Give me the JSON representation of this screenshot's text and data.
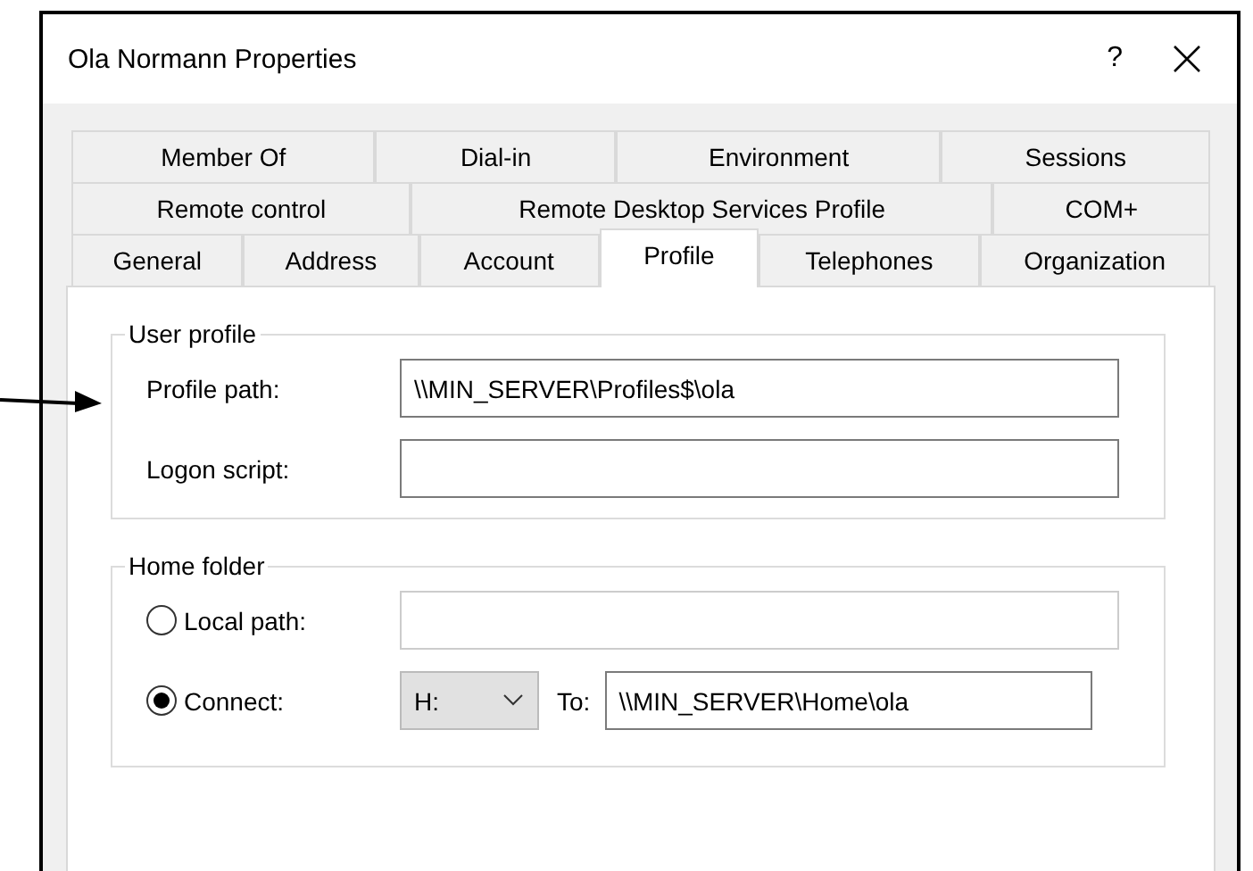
{
  "window": {
    "title": "Ola Normann Properties",
    "help": "?"
  },
  "tab_rows": [
    [
      {
        "label": "Member Of",
        "selected": false
      },
      {
        "label": "Dial-in",
        "selected": false
      },
      {
        "label": "Environment",
        "selected": false
      },
      {
        "label": "Sessions",
        "selected": false
      }
    ],
    [
      {
        "label": "Remote control",
        "selected": false
      },
      {
        "label": "Remote Desktop Services Profile",
        "selected": false
      },
      {
        "label": "COM+",
        "selected": false
      }
    ],
    [
      {
        "label": "General",
        "selected": false
      },
      {
        "label": "Address",
        "selected": false
      },
      {
        "label": "Account",
        "selected": false
      },
      {
        "label": "Profile",
        "selected": true
      },
      {
        "label": "Telephones",
        "selected": false
      },
      {
        "label": "Organization",
        "selected": false
      }
    ]
  ],
  "user_profile": {
    "legend": "User profile",
    "fields": [
      {
        "label": "Profile path:",
        "value": "\\\\MIN_SERVER\\Profiles$\\ola"
      },
      {
        "label": "Logon script:"
      }
    ]
  },
  "home_folder": {
    "legend": "Home folder",
    "options": [
      {
        "kind": "path",
        "label": "Local path:",
        "selected": false,
        "disabled": true
      },
      {
        "kind": "connect",
        "label": "Connect:",
        "selected": true,
        "drive": "H:",
        "to_label": "To:",
        "value": "\\\\MIN_SERVER\\Home\\ola"
      }
    ]
  }
}
